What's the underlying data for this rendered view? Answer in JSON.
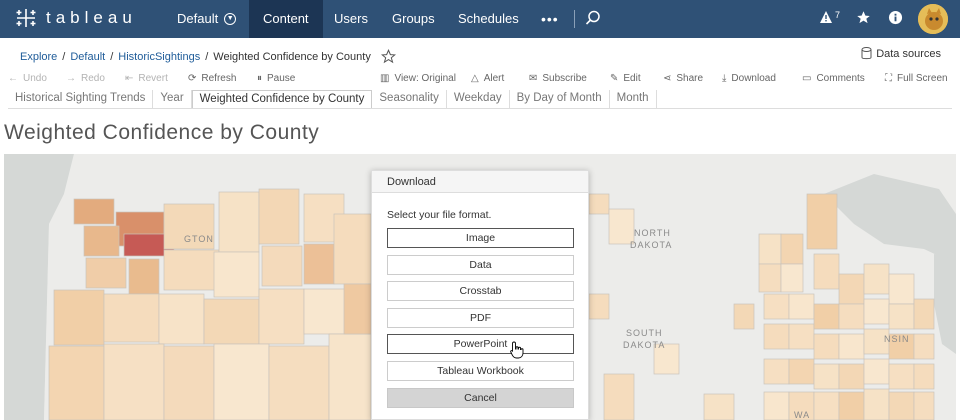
{
  "brand": {
    "logo_text": "tableau"
  },
  "nav": {
    "site": "Default",
    "items": [
      "Content",
      "Users",
      "Groups",
      "Schedules"
    ],
    "active": "Content",
    "more": "•••",
    "alert_count": "7"
  },
  "breadcrumb": {
    "items": [
      "Explore",
      "Default",
      "HistoricSightings"
    ],
    "current": "Weighted Confidence by County",
    "data_sources": "Data sources"
  },
  "toolbar": {
    "undo": "Undo",
    "redo": "Redo",
    "revert": "Revert",
    "refresh": "Refresh",
    "pause": "Pause",
    "view": "View: Original",
    "alert": "Alert",
    "subscribe": "Subscribe",
    "edit": "Edit",
    "share": "Share",
    "download": "Download",
    "comments": "Comments",
    "fullscreen": "Full Screen"
  },
  "tabs": [
    "Historical Sighting Trends",
    "Year",
    "Weighted Confidence by County",
    "Seasonality",
    "Weekday",
    "By Day of Month",
    "Month"
  ],
  "active_tab": "Weighted Confidence by County",
  "page_title": "Weighted Confidence by County",
  "map_labels": {
    "washington": "GTON",
    "north_dakota_1": "NORTH",
    "north_dakota_2": "DAKOTA",
    "south_dakota_1": "SOUTH",
    "south_dakota_2": "DAKOTA",
    "wisconsin": "NSIN",
    "iowa": "WA"
  },
  "dialog": {
    "title": "Download",
    "prompt": "Select your file format.",
    "options": [
      "Image",
      "Data",
      "Crosstab",
      "PDF",
      "PowerPoint",
      "Tableau Workbook"
    ],
    "cancel": "Cancel"
  },
  "colors": {
    "nav_bg": "#2f5176",
    "nav_active": "#1c3554",
    "link": "#1f5c99",
    "map_low": "#f6e2c6",
    "map_mid": "#eab98a",
    "map_high": "#c65a55"
  }
}
